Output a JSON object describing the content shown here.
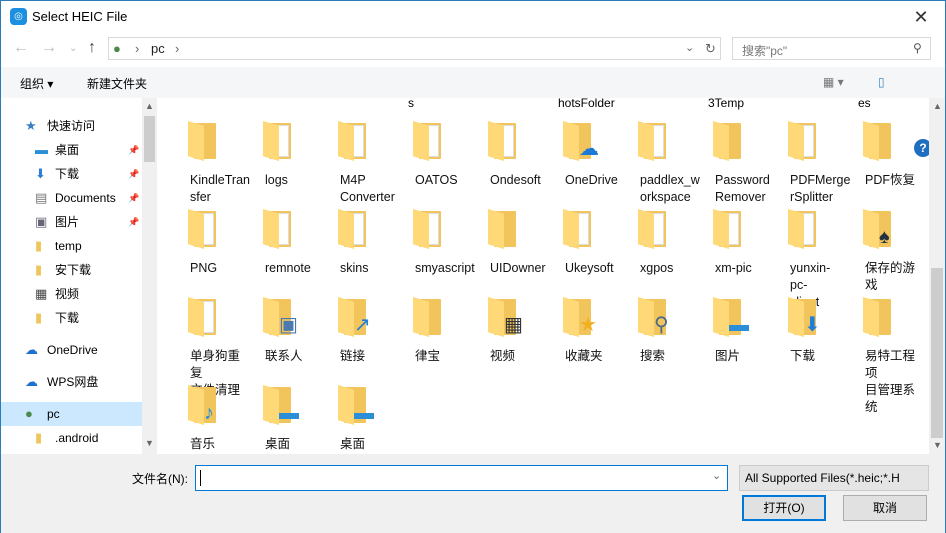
{
  "window": {
    "title": "Select HEIC File",
    "close_icon": "close-icon"
  },
  "nav": {
    "path": [
      "pc"
    ],
    "search_placeholder": "搜索\"pc\""
  },
  "toolbar": {
    "organize": "组织 ▾",
    "new_folder": "新建文件夹"
  },
  "sidebar": {
    "items": [
      {
        "label": "快速访问",
        "icon": "star-icon",
        "pinned": false,
        "indent": 1
      },
      {
        "label": "桌面",
        "icon": "desktop-icon",
        "pinned": true,
        "indent": 2
      },
      {
        "label": "下载",
        "icon": "download-icon",
        "pinned": true,
        "indent": 2
      },
      {
        "label": "Documents",
        "icon": "document-icon",
        "pinned": true,
        "indent": 2
      },
      {
        "label": "图片",
        "icon": "pictures-icon",
        "pinned": true,
        "indent": 2
      },
      {
        "label": "temp",
        "icon": "folder-icon",
        "pinned": false,
        "indent": 2
      },
      {
        "label": "安下载",
        "icon": "folder-icon",
        "pinned": false,
        "indent": 2
      },
      {
        "label": "视频",
        "icon": "video-icon",
        "pinned": false,
        "indent": 2
      },
      {
        "label": "下载",
        "icon": "folder-icon",
        "pinned": false,
        "indent": 2
      },
      {
        "label": "OneDrive",
        "icon": "cloud-icon",
        "pinned": false,
        "indent": 1
      },
      {
        "label": "WPS网盘",
        "icon": "cloud-icon",
        "pinned": false,
        "indent": 1
      },
      {
        "label": "pc",
        "icon": "user-icon",
        "pinned": false,
        "indent": 1,
        "selected": true
      },
      {
        "label": ".android",
        "icon": "folder-icon",
        "pinned": false,
        "indent": 2
      }
    ]
  },
  "content": {
    "partial_row": [
      "s",
      "hotsFolder",
      "3Temp",
      "es"
    ],
    "items": [
      {
        "name": "KindleTran\nsfer",
        "overlay": ""
      },
      {
        "name": "logs",
        "overlay": "page"
      },
      {
        "name": "M4P\nConverter",
        "overlay": "page"
      },
      {
        "name": "OATOS",
        "overlay": "page"
      },
      {
        "name": "Ondesoft",
        "overlay": "page"
      },
      {
        "name": "OneDrive",
        "overlay": "☁"
      },
      {
        "name": "paddlex_w\norkspace",
        "overlay": "page"
      },
      {
        "name": "Password\nRemover",
        "overlay": ""
      },
      {
        "name": "PDFMerge\nrSplitter",
        "overlay": "page"
      },
      {
        "name": "PDF恢复",
        "overlay": ""
      },
      {
        "name": "PNG",
        "overlay": "page"
      },
      {
        "name": "remnote",
        "overlay": "page"
      },
      {
        "name": "skins",
        "overlay": "page"
      },
      {
        "name": "smyascript",
        "overlay": "page"
      },
      {
        "name": "UIDowner",
        "overlay": ""
      },
      {
        "name": "Ukeysoft",
        "overlay": "page"
      },
      {
        "name": "xgpos",
        "overlay": "page"
      },
      {
        "name": "xm-pic",
        "overlay": "page"
      },
      {
        "name": "yunxin-pc-\nclient",
        "overlay": "page"
      },
      {
        "name": "保存的游戏",
        "overlay": "♠"
      },
      {
        "name": "单身狗重复\n文件清理",
        "overlay": "page"
      },
      {
        "name": "联系人",
        "overlay": "▣"
      },
      {
        "name": "链接",
        "overlay": "↗"
      },
      {
        "name": "律宝",
        "overlay": ""
      },
      {
        "name": "视频",
        "overlay": "▦"
      },
      {
        "name": "收藏夹",
        "overlay": "★"
      },
      {
        "name": "搜索",
        "overlay": "⚲"
      },
      {
        "name": "图片",
        "overlay": "▬"
      },
      {
        "name": "下载",
        "overlay": "⬇"
      },
      {
        "name": "易特工程项\n目管理系统",
        "overlay": ""
      },
      {
        "name": "音乐",
        "overlay": "♪"
      },
      {
        "name": "桌面",
        "overlay": "▬"
      },
      {
        "name": "桌面",
        "overlay": "▬"
      }
    ]
  },
  "bottom": {
    "filename_label": "文件名(N):",
    "filename_value": "",
    "filetype": "All Supported Files(*.heic;*.H",
    "open": "打开(O)",
    "cancel": "取消"
  },
  "colors": {
    "accent": "#0078d7",
    "selected": "#cce8ff",
    "folder": "#ffd978"
  }
}
